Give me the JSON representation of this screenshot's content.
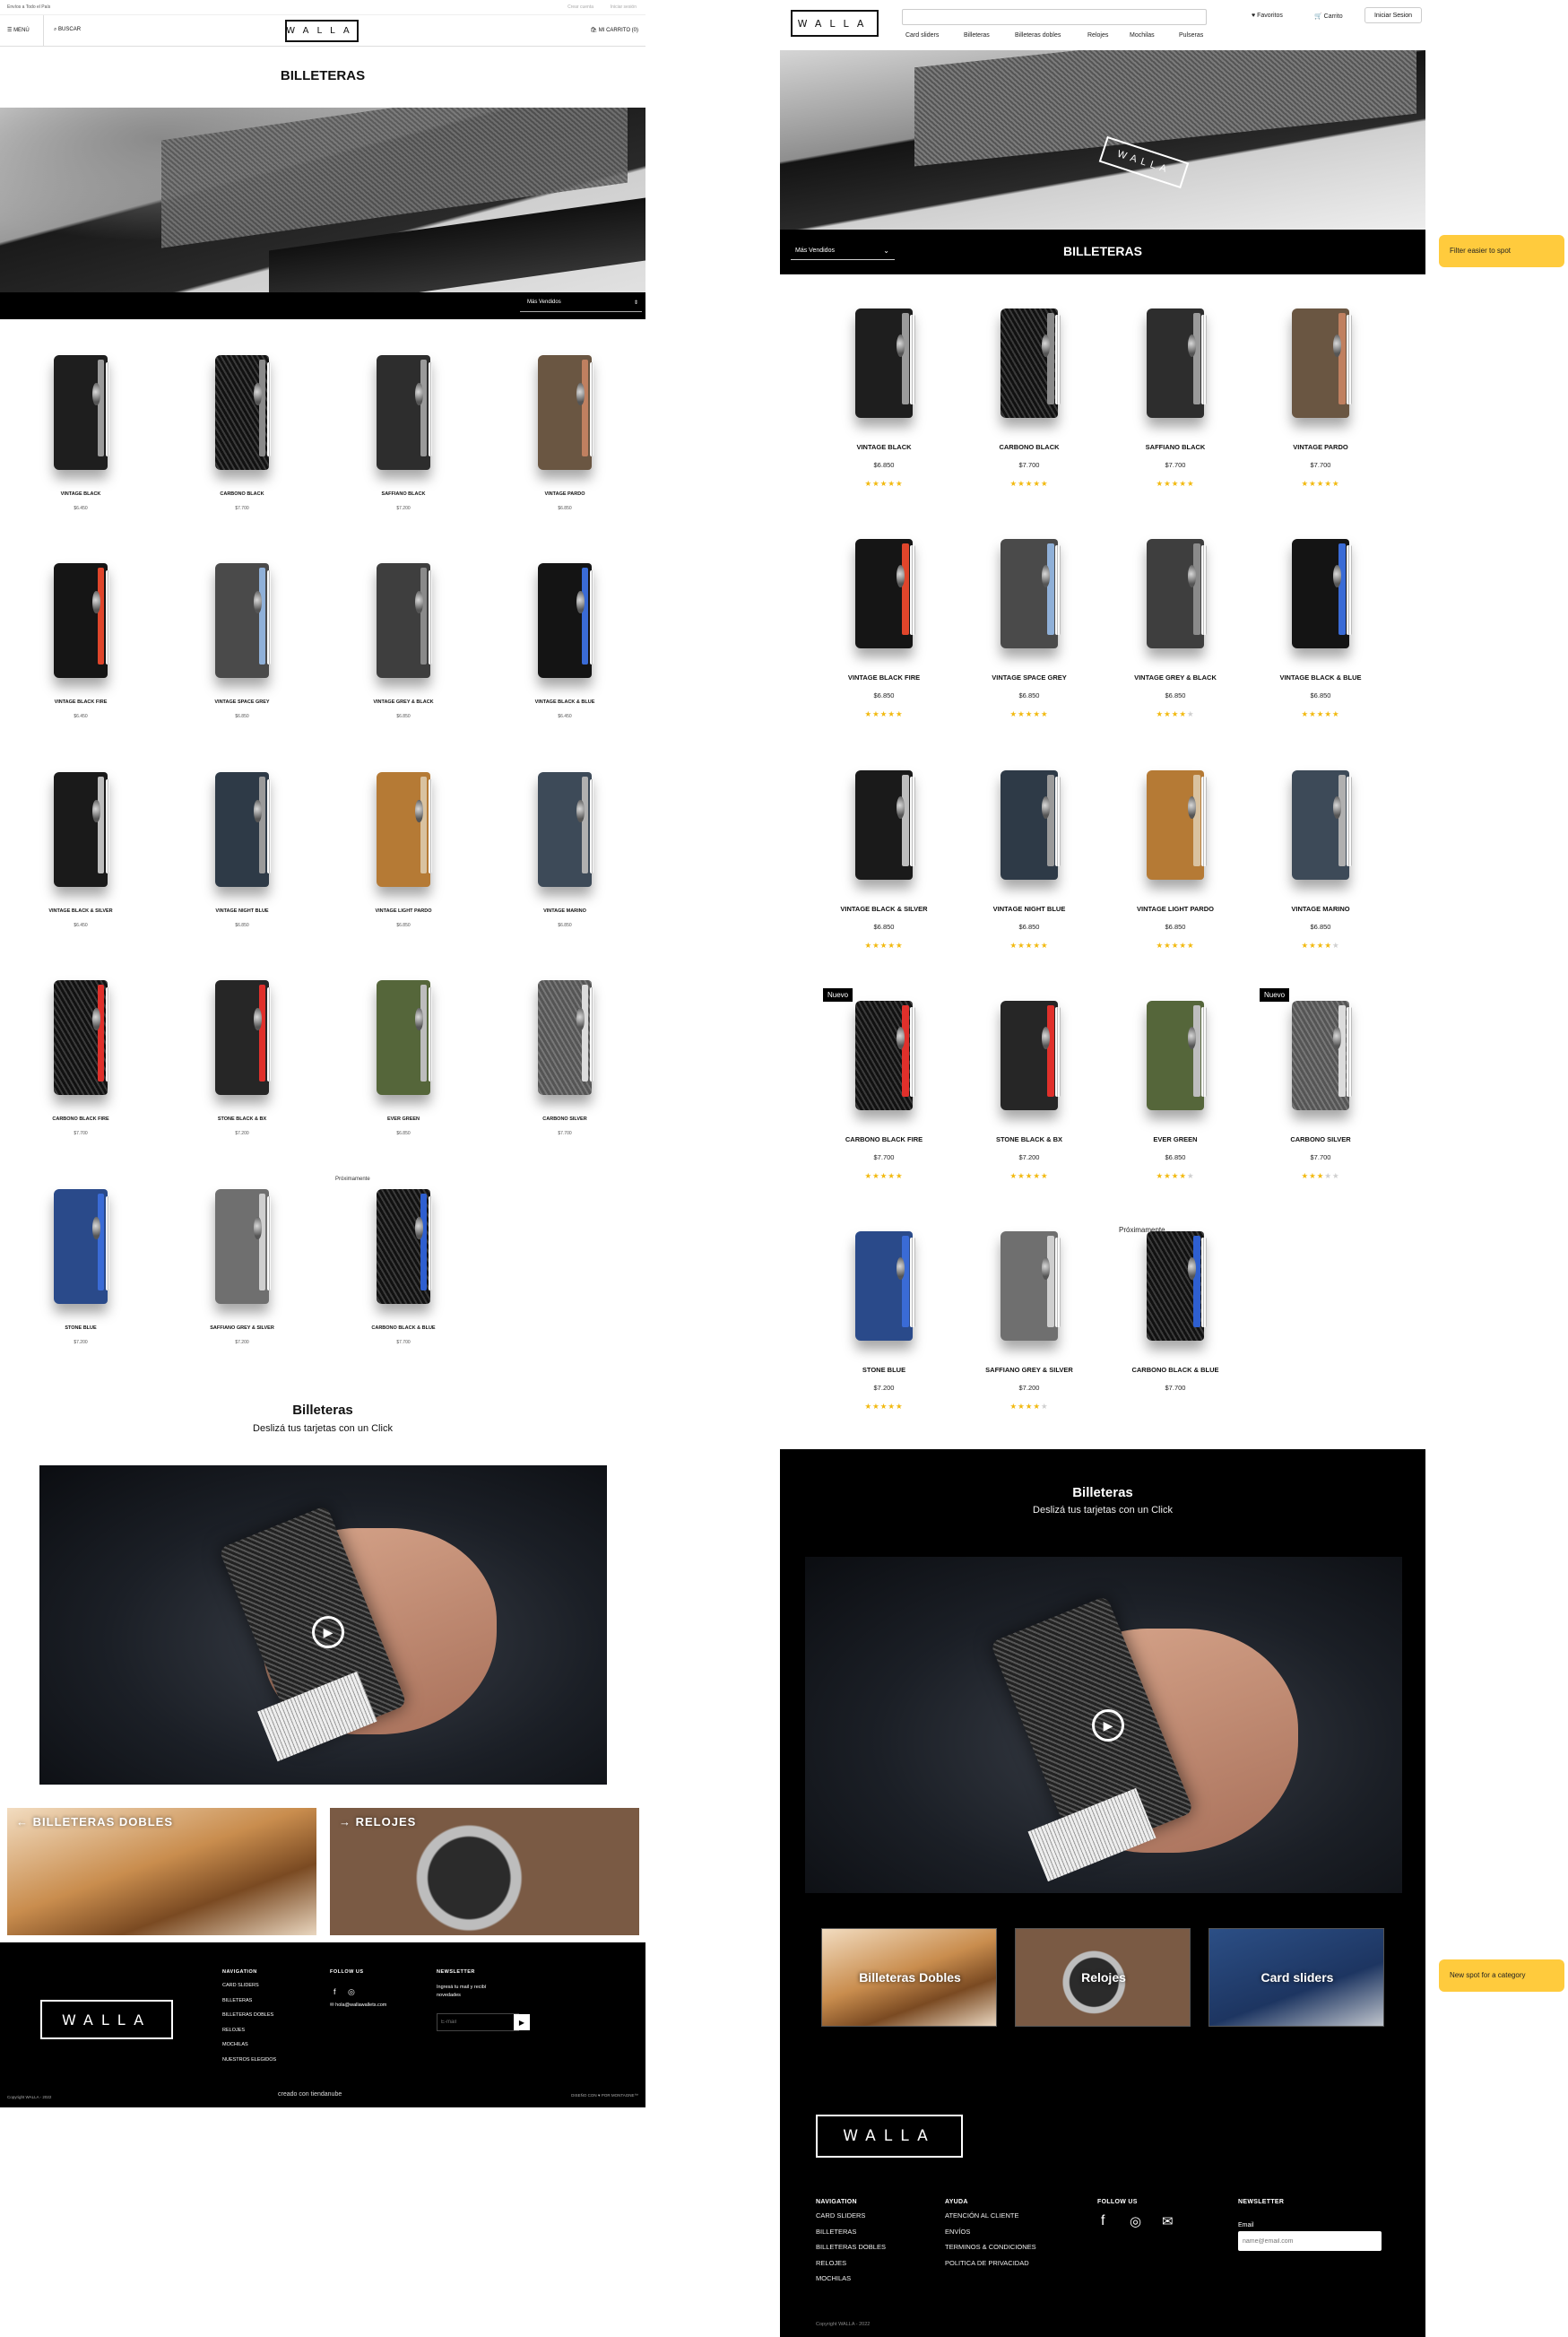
{
  "colors": {
    "black": "#000000",
    "white": "#ffffff",
    "star": "#f2b90f",
    "callout": "#ffcb3d"
  },
  "left": {
    "topline": {
      "shipping": "Envíos a Todo el País",
      "account": "Crear cuenta",
      "login": "Iniciar sesión"
    },
    "header": {
      "menu_label": "MENÚ",
      "search_label": "BUSCAR",
      "logo": "WALLA",
      "cart_label": "MI CARRITO (0)"
    },
    "page_title": "BILLETERAS",
    "sort": {
      "label": "Más Vendidos"
    },
    "products": [
      {
        "name": "VINTAGE BLACK",
        "price": "$6.450"
      },
      {
        "name": "CARBONO BLACK",
        "price": "$7.700"
      },
      {
        "name": "SAFFIANO BLACK",
        "price": "$7.200"
      },
      {
        "name": "VINTAGE PARDO",
        "price": "$6.850"
      },
      {
        "name": "VINTAGE BLACK FIRE",
        "price": "$6.450"
      },
      {
        "name": "VINTAGE SPACE GREY",
        "price": "$6.850"
      },
      {
        "name": "VINTAGE GREY & BLACK",
        "price": "$6.850"
      },
      {
        "name": "VINTAGE BLACK & BLUE",
        "price": "$6.450"
      },
      {
        "name": "VINTAGE BLACK & SILVER",
        "price": "$6.450"
      },
      {
        "name": "VINTAGE NIGHT BLUE",
        "price": "$6.850"
      },
      {
        "name": "VINTAGE LIGHT PARDO",
        "price": "$6.850"
      },
      {
        "name": "VINTAGE MARINO",
        "price": "$6.850"
      },
      {
        "name": "CARBONO BLACK FIRE",
        "price": "$7.700"
      },
      {
        "name": "STONE BLACK & BX",
        "price": "$7.200"
      },
      {
        "name": "EVER GREEN",
        "price": "$6.850"
      },
      {
        "name": "CARBONO SILVER",
        "price": "$7.700"
      },
      {
        "name": "STONE BLUE",
        "price": "$7.200"
      },
      {
        "name": "SAFFIANO GREY & SILVER",
        "price": "$7.200"
      },
      {
        "name": "CARBONO BLACK & BLUE",
        "price": "$7.700"
      }
    ],
    "soon_badge": "Próximamente",
    "video": {
      "title": "Billeteras",
      "subtitle": "Deslizá tus tarjetas con un Click"
    },
    "categories": [
      {
        "label": "BILLETERAS DOBLES",
        "icon": "arrow-left-icon"
      },
      {
        "label": "RELOJES",
        "icon": "arrow-right-icon"
      }
    ],
    "footer": {
      "logo": "WALLA",
      "nav_title": "NAVIGATION",
      "nav_items": [
        "CARD SLIDERS",
        "BILLETERAS",
        "BILLETERAS DOBLES",
        "RELOJES",
        "MOCHILAS",
        "NUESTROS ELEGIDOS"
      ],
      "follow_title": "FOLLOW US",
      "email": "hola@wallawallets.com",
      "newsletter_title": "NEWSLETTER",
      "newsletter_text": "Ingresá tu mail y recibí novedades",
      "email_placeholder": "E-mail",
      "copyright": "Copyright WALLA - 2022",
      "made_with": "creado con  tiendanube",
      "design_credit": "DISEÑO CON ♥ POR MONTAGNE™"
    }
  },
  "right": {
    "header": {
      "logo": "WALLA",
      "search_placeholder": "",
      "nav": [
        "Card sliders",
        "Billeteras",
        "Billeteras dobles",
        "Relojes",
        "Mochilas",
        "Pulseras"
      ],
      "favorites": "Favoritos",
      "cart": "Carrito",
      "login": "Iniciar Sesion"
    },
    "sort": {
      "label": "Más Vendidos"
    },
    "page_title": "BILLETERAS",
    "products": [
      {
        "name": "VINTAGE BLACK",
        "price": "$6.850",
        "rating": 5
      },
      {
        "name": "CARBONO BLACK",
        "price": "$7.700",
        "rating": 5
      },
      {
        "name": "SAFFIANO BLACK",
        "price": "$7.700",
        "rating": 5
      },
      {
        "name": "VINTAGE PARDO",
        "price": "$7.700",
        "rating": 5
      },
      {
        "name": "VINTAGE BLACK FIRE",
        "price": "$6.850",
        "rating": 5
      },
      {
        "name": "VINTAGE SPACE GREY",
        "price": "$6.850",
        "rating": 5
      },
      {
        "name": "VINTAGE GREY & BLACK",
        "price": "$6.850",
        "rating": 4
      },
      {
        "name": "VINTAGE BLACK & BLUE",
        "price": "$6.850",
        "rating": 5
      },
      {
        "name": "VINTAGE BLACK & SILVER",
        "price": "$6.850",
        "rating": 5
      },
      {
        "name": "VINTAGE NIGHT BLUE",
        "price": "$6.850",
        "rating": 5
      },
      {
        "name": "VINTAGE LIGHT PARDO",
        "price": "$6.850",
        "rating": 5
      },
      {
        "name": "VINTAGE MARINO",
        "price": "$6.850",
        "rating": 4
      },
      {
        "name": "CARBONO BLACK FIRE",
        "price": "$7.700",
        "rating": 5
      },
      {
        "name": "STONE BLACK & BX",
        "price": "$7.200",
        "rating": 5
      },
      {
        "name": "EVER GREEN",
        "price": "$6.850",
        "rating": 4
      },
      {
        "name": "CARBONO SILVER",
        "price": "$7.700",
        "rating": 3.5
      },
      {
        "name": "STONE BLUE",
        "price": "$7.200",
        "rating": 5
      },
      {
        "name": "SAFFIANO GREY & SILVER",
        "price": "$7.200",
        "rating": 4.5
      },
      {
        "name": "CARBONO BLACK & BLUE",
        "price": "$7.700",
        "rating": 0
      }
    ],
    "new_badge": "Nuevo",
    "soon_badge": "Próximamente",
    "video": {
      "title": "Billeteras",
      "subtitle": "Deslizá tus tarjetas con un Click"
    },
    "categories": [
      {
        "label": "Billeteras Dobles"
      },
      {
        "label": "Relojes"
      },
      {
        "label": "Card sliders"
      }
    ],
    "footer": {
      "logo": "WALLA",
      "nav_title": "NAVIGATION",
      "nav_items": [
        "CARD SLIDERS",
        "BILLETERAS",
        "BILLETERAS DOBLES",
        "RELOJES",
        "MOCHILAS"
      ],
      "help_title": "AYUDA",
      "help_items": [
        "ATENCIÓN AL CLIENTE",
        "ENVÍOS",
        "TERMINOS & CONDICIONES",
        "POLITICA DE PRIVACIDAD"
      ],
      "follow_title": "FOLLOW US",
      "newsletter_title": "NEWSLETTER",
      "email_label": "Email",
      "email_placeholder": "name@email.com",
      "copyright": "Copyright WALLA - 2022"
    }
  },
  "callouts": {
    "filter": "Filter easier to spot",
    "category": "New spot for a category"
  }
}
